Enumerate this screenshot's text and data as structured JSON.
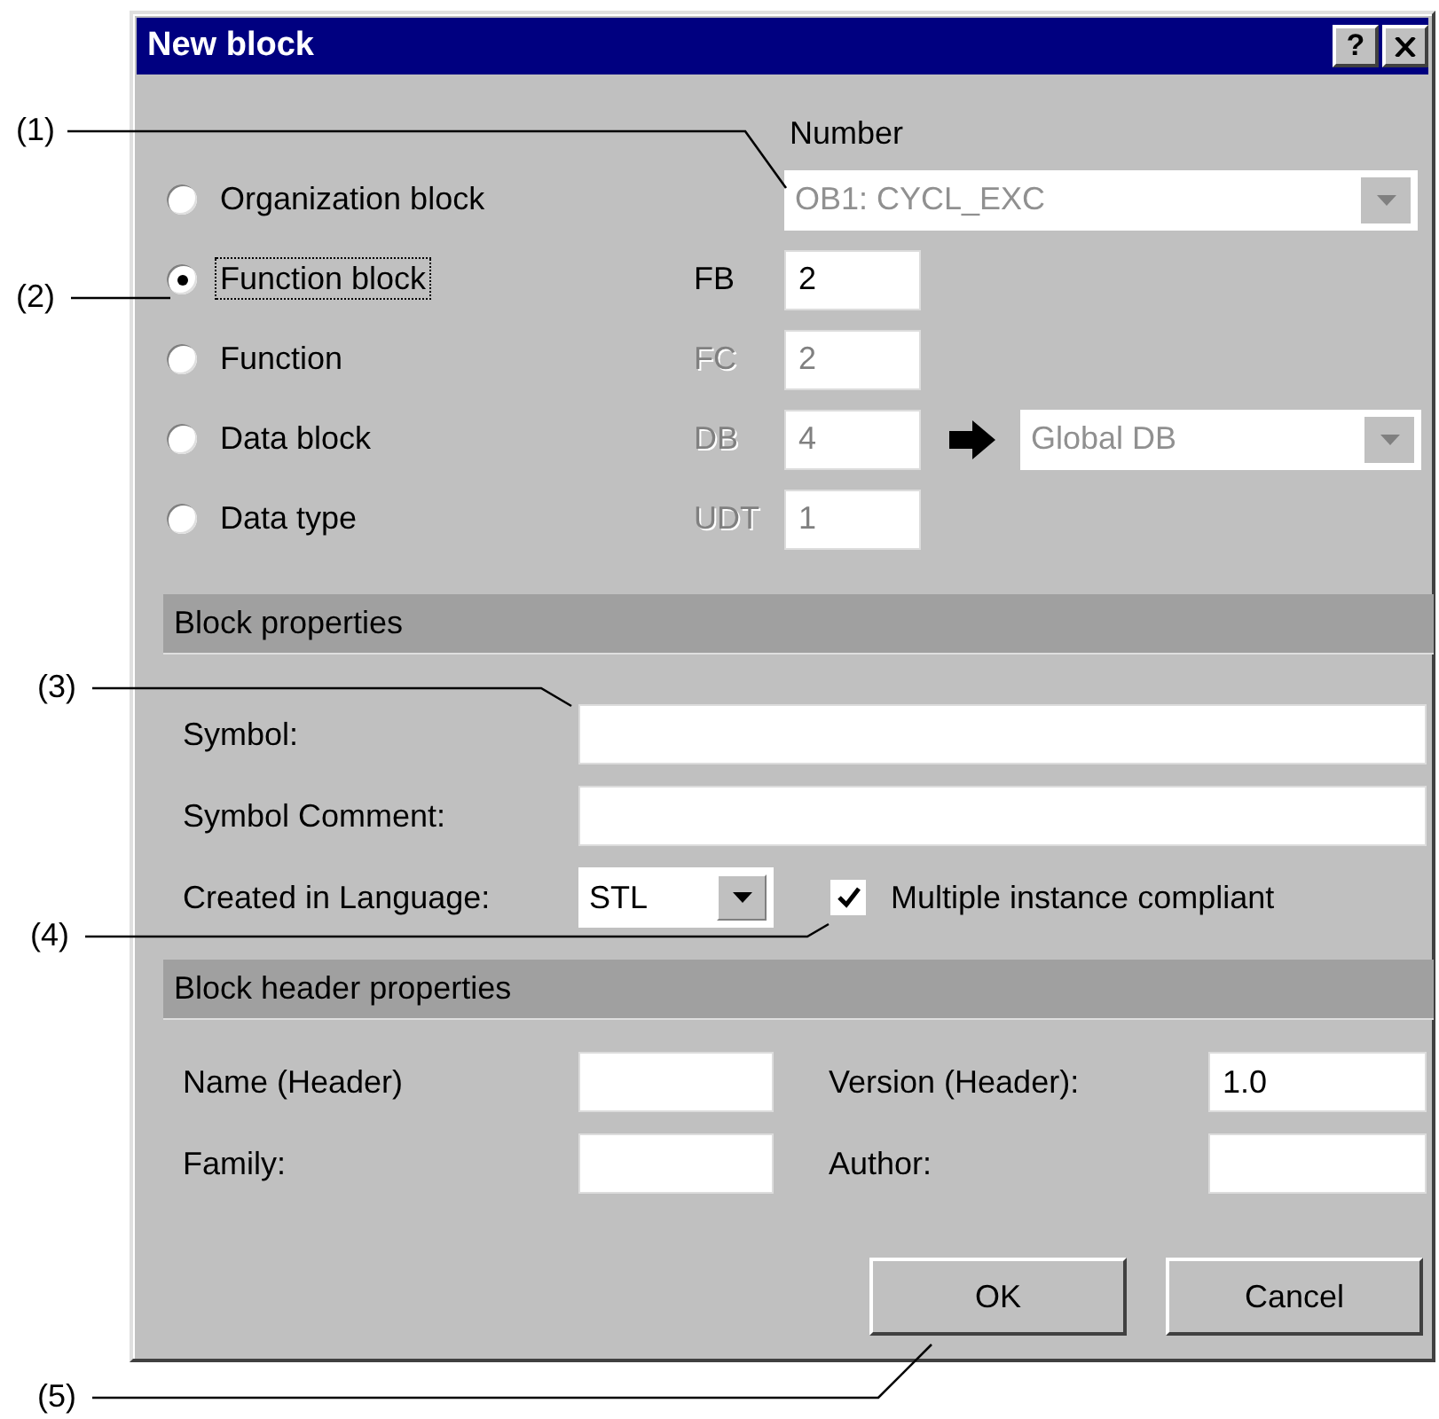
{
  "window": {
    "title": "New block",
    "help": "?"
  },
  "number_label": "Number",
  "block_types": [
    {
      "label": "Organization block",
      "selected": false,
      "focused": false,
      "kind": "dropdown",
      "value": "OB1: CYCL_EXC",
      "disabled": true
    },
    {
      "label": "Function block",
      "selected": true,
      "focused": true,
      "kind": "field",
      "prefix": "FB",
      "value": "2",
      "disabled": false
    },
    {
      "label": "Function",
      "selected": false,
      "focused": false,
      "kind": "field",
      "prefix": "FC",
      "value": "2",
      "disabled": true
    },
    {
      "label": "Data block",
      "selected": false,
      "focused": false,
      "kind": "field_dropdown",
      "prefix": "DB",
      "value": "4",
      "dropdown": "Global DB",
      "disabled": true
    },
    {
      "label": "Data type",
      "selected": false,
      "focused": false,
      "kind": "field",
      "prefix": "UDT",
      "value": "1",
      "disabled": true
    }
  ],
  "block_properties": {
    "title": "Block properties",
    "fields": [
      {
        "label": "Symbol:"
      },
      {
        "label": "Symbol Comment:"
      }
    ],
    "language": {
      "label": "Created in Language:",
      "value": "STL"
    },
    "checkbox": {
      "label": "Multiple instance compliant",
      "checked": true
    }
  },
  "header_properties": {
    "title": "Block header properties",
    "fields": [
      {
        "label": "Name (Header)"
      },
      {
        "label": "Version (Header):",
        "value": "1.0"
      },
      {
        "label": "Family:"
      },
      {
        "label": "Author:"
      }
    ]
  },
  "buttons": [
    {
      "label": "OK"
    },
    {
      "label": "Cancel"
    }
  ],
  "callouts": [
    "(1)",
    "(2)",
    "(3)",
    "(4)",
    "(5)"
  ]
}
